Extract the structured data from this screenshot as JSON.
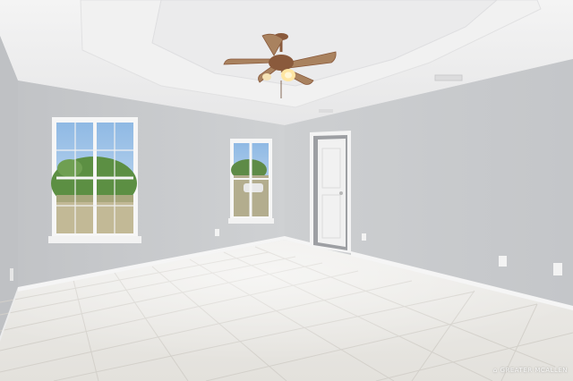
{
  "scene": {
    "subject": "empty-room",
    "colors": {
      "wall": "#c9cbcd",
      "wall_shadow": "#b9bbbe",
      "ceiling": "#efefef",
      "floor_tile": "#e9e7e2",
      "grout": "#cfccc6",
      "trim": "#f4f4f4",
      "fan_blade": "#a9825f",
      "fan_metal": "#8a5a3c",
      "sky": "#9cc3e9",
      "foliage": "#5c8f43"
    }
  },
  "watermark": {
    "text": "GREATER MCALLEN",
    "icon": "house-icon"
  }
}
